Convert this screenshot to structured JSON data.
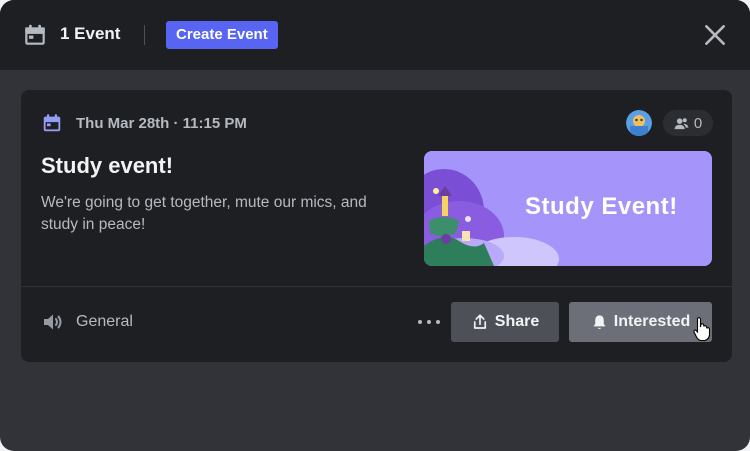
{
  "header": {
    "event_count": "1 Event",
    "create_label": "Create Event"
  },
  "event": {
    "datetime": "Thu Mar 28th · 11:15 PM",
    "interested_count": "0",
    "title": "Study event!",
    "description": "We're going to get together, mute our mics, and study in peace!",
    "banner_text": "Study Event!",
    "location": "General"
  },
  "actions": {
    "share_label": "Share",
    "interested_label": "Interested"
  },
  "colors": {
    "accent": "#5865f2",
    "banner": "#a594f9",
    "calendar_icon": "#949cf7"
  },
  "icons": [
    "calendar-icon",
    "close-icon",
    "users-icon",
    "speaker-icon",
    "more-icon",
    "share-icon",
    "bell-icon"
  ]
}
